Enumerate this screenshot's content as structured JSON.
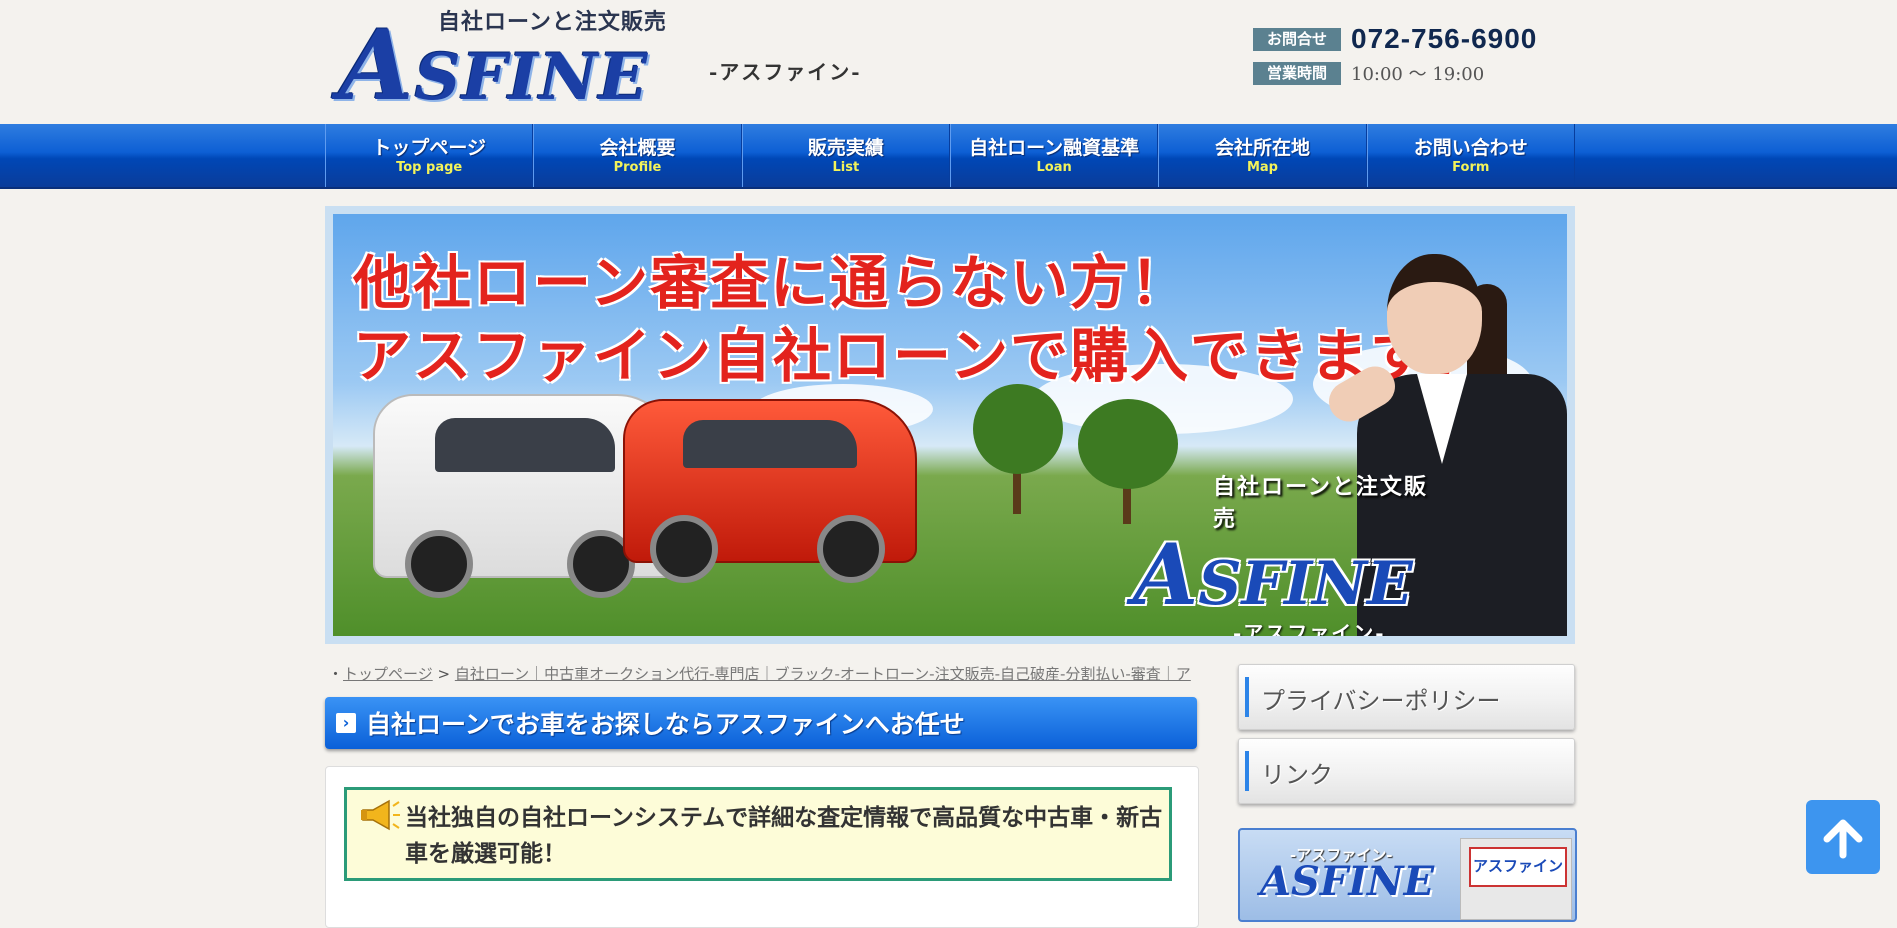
{
  "header": {
    "logo_tagline": "自社ローンと注文販売",
    "logo_word_first": "A",
    "logo_word_rest": "SFINE",
    "logo_kana": "-アスファイン-",
    "contact_badge": "お問合せ",
    "phone": "072-756-6900",
    "hours_badge": "営業時間",
    "hours": "10:00 ～ 19:00"
  },
  "nav": {
    "items": [
      {
        "jp": "トップページ",
        "en": "Top page"
      },
      {
        "jp": "会社概要",
        "en": "Profile"
      },
      {
        "jp": "販売実績",
        "en": "List"
      },
      {
        "jp": "自社ローン融資基準",
        "en": "Loan"
      },
      {
        "jp": "会社所在地",
        "en": "Map"
      },
      {
        "jp": "お問い合わせ",
        "en": "Form"
      }
    ]
  },
  "hero": {
    "line1": "他社ローン審査に通らない方！",
    "line2": "アスファイン自社ローンで購入できます！",
    "logo_tagline": "自社ローンと注文販売",
    "logo_word_first": "A",
    "logo_word_rest": "SFINE",
    "logo_kana": "-アスファイン-"
  },
  "breadcrumb": {
    "bullet": "・",
    "home": "トップページ",
    "separator": " > ",
    "current": "自社ローン｜中古車オークション代行-専門店｜ブラック-オートローン-注文販売-自己破産-分割払い-審査｜ア"
  },
  "main": {
    "heading_icon": "›",
    "heading": "自社ローンでお車をお探しならアスファインへお任せ",
    "notice": "当社独自の自社ローンシステムで詳細な査定情報で高品質な中古車・新古車を厳選可能！"
  },
  "sidebar": {
    "items": [
      {
        "label": "プライバシーポリシー"
      },
      {
        "label": "リンク"
      }
    ],
    "banner_tag": "-アスファイン-",
    "banner_word": "ASFINE",
    "banner_shop_sign": "アスファイン"
  },
  "colors": {
    "nav_blue": "#0d5fd4",
    "nav_en_text": "#f3f35a",
    "heading_blue": "#0a60d8",
    "notice_border": "#2b9b78",
    "notice_bg": "#fdfcd8",
    "hero_text_red": "#e3231d",
    "to_top_blue": "#3d95ef"
  }
}
